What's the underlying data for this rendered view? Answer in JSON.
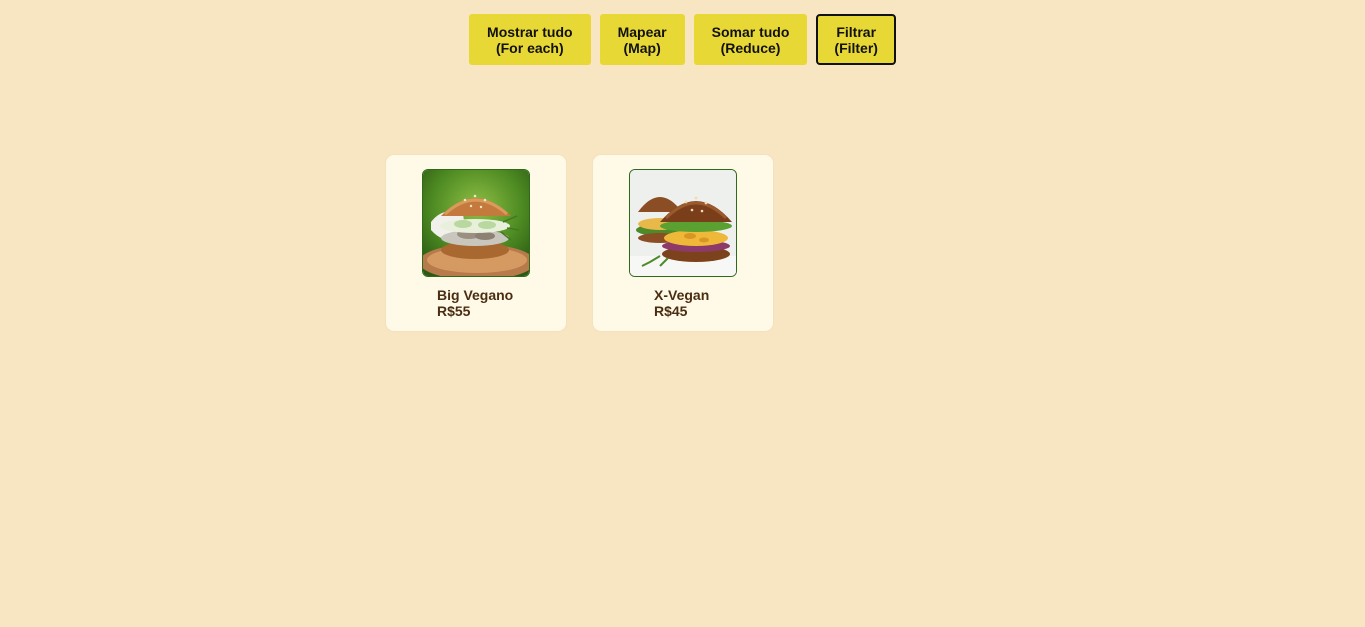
{
  "toolbar": {
    "buttons": [
      {
        "line1": "Mostrar tudo",
        "line2": "(For each)"
      },
      {
        "line1": "Mapear",
        "line2": "(Map)"
      },
      {
        "line1": "Somar tudo",
        "line2": "(Reduce)"
      },
      {
        "line1": "Filtrar",
        "line2": "(Filter)"
      }
    ],
    "active_index": 3
  },
  "products": [
    {
      "name": "Big Vegano",
      "price": "R$55",
      "image_icon": "burger-mushroom-image"
    },
    {
      "name": "X-Vegan",
      "price": "R$45",
      "image_icon": "double-burger-image"
    }
  ],
  "colors": {
    "background": "#f8e6c2",
    "button": "#e8d835",
    "card": "#fffae8",
    "text": "#4a2e12"
  }
}
